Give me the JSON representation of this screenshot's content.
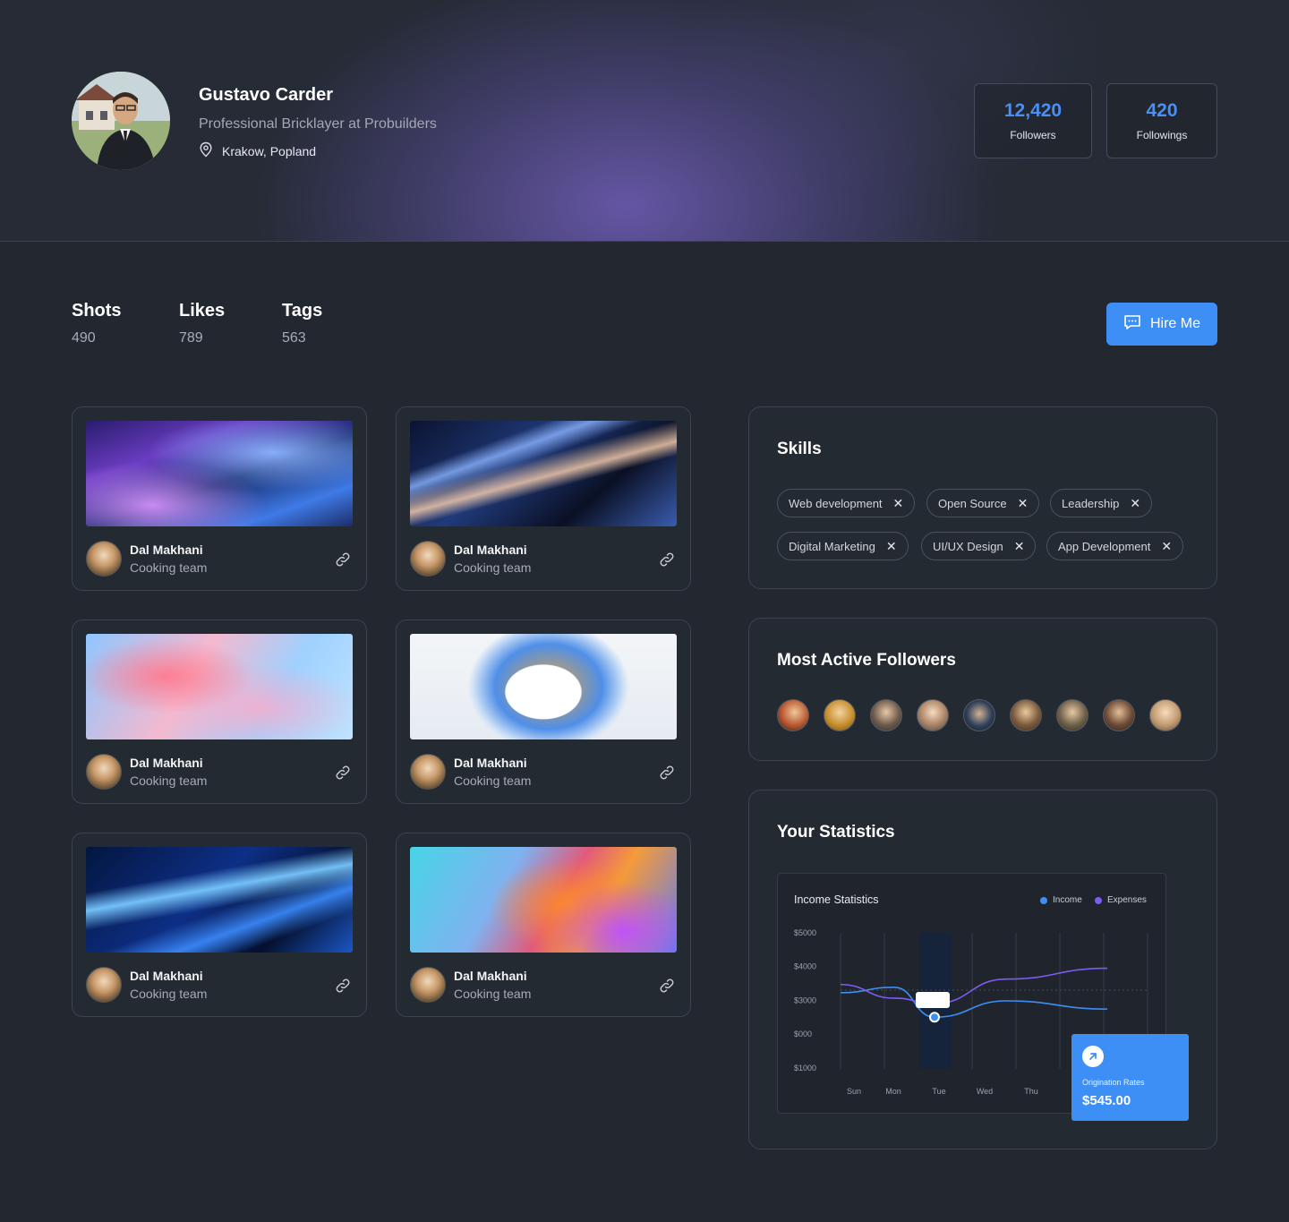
{
  "profile": {
    "name": "Gustavo Carder",
    "title": "Professional Bricklayer at Probuilders",
    "location": "Krakow, Popland"
  },
  "header_stats": [
    {
      "value": "12,420",
      "label": "Followers"
    },
    {
      "value": "420",
      "label": "Followings"
    }
  ],
  "counts": [
    {
      "label": "Shots",
      "value": "490"
    },
    {
      "label": "Likes",
      "value": "789"
    },
    {
      "label": "Tags",
      "value": "563"
    }
  ],
  "hire_button": {
    "label": "Hire Me",
    "icon": "chat-icon"
  },
  "shots": [
    {
      "author": "Dal Makhani",
      "team": "Cooking team",
      "icon": "link-icon"
    },
    {
      "author": "Dal Makhani",
      "team": "Cooking team",
      "icon": "link-icon"
    },
    {
      "author": "Dal Makhani",
      "team": "Cooking team",
      "icon": "link-icon"
    },
    {
      "author": "Dal Makhani",
      "team": "Cooking team",
      "icon": "link-icon"
    },
    {
      "author": "Dal Makhani",
      "team": "Cooking team",
      "icon": "link-icon"
    },
    {
      "author": "Dal Makhani",
      "team": "Cooking team",
      "icon": "link-icon"
    }
  ],
  "skills": {
    "title": "Skills",
    "items": [
      "Web development",
      "Open Source",
      "Leadership",
      "Digital Marketing",
      "UI/UX Design",
      "App Development"
    ]
  },
  "followers": {
    "title": "Most Active Followers",
    "count": 9
  },
  "statistics": {
    "title": "Your Statistics",
    "origination": {
      "label": "Origination Rates",
      "value": "$545.00",
      "icon": "arrow-up-right-icon"
    }
  },
  "colors": {
    "accent": "#3d8ff5",
    "income": "#3d8ff5",
    "expenses": "#7b5cf0"
  },
  "chart_data": {
    "type": "line",
    "title": "Income Statistics",
    "categories": [
      "Sun",
      "Mon",
      "Tue",
      "Wed",
      "Thu"
    ],
    "y_ticks": [
      "$5000",
      "$4000",
      "$3000",
      "$000",
      "$1000"
    ],
    "ylim": [
      0,
      5000
    ],
    "series": [
      {
        "name": "Income",
        "values": [
          2800,
          3000,
          1900,
          2500,
          2200
        ]
      },
      {
        "name": "Expenses",
        "values": [
          3100,
          2600,
          2400,
          3300,
          3700
        ]
      }
    ],
    "legend": "top-right",
    "grid": true
  }
}
